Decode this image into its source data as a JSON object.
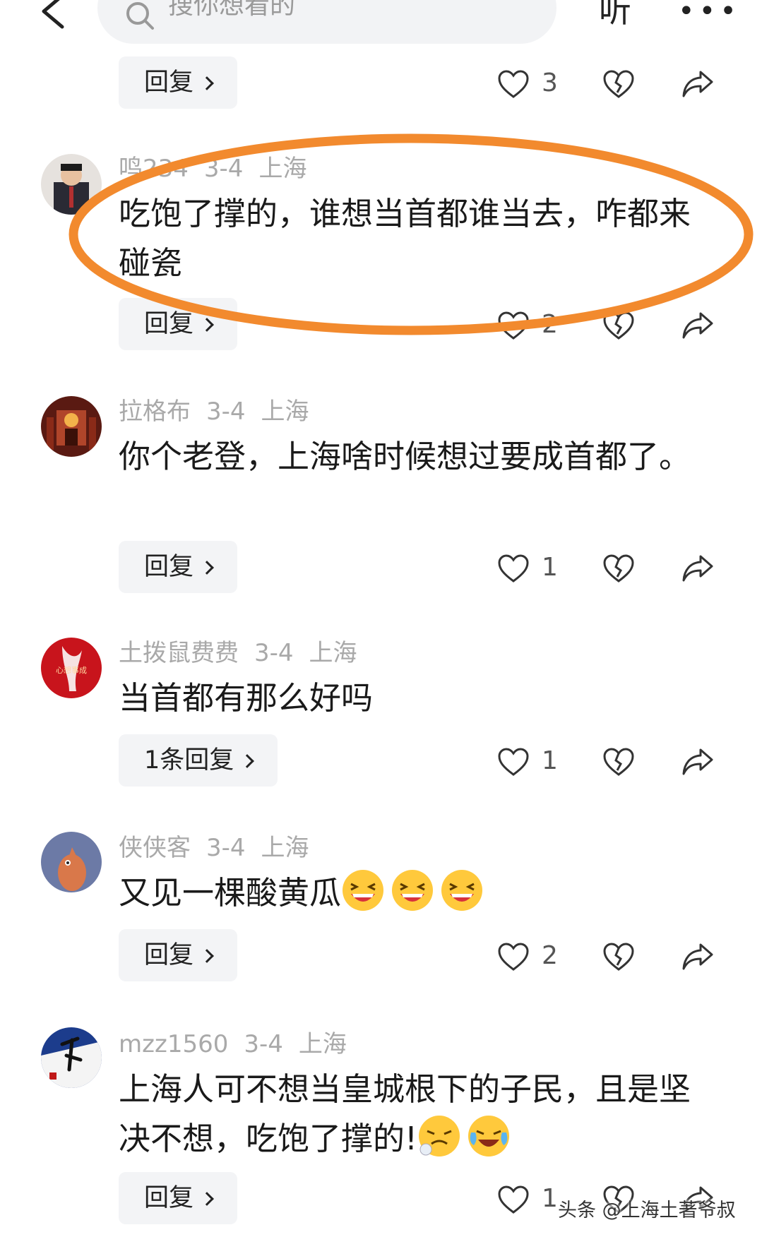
{
  "header": {
    "search_placeholder": "搜你想看的",
    "listen_label": "听",
    "more_label": "•••"
  },
  "comments": [
    {
      "username": "",
      "date": "",
      "location": "",
      "text": "",
      "reply_label": "回复",
      "likes": "3"
    },
    {
      "username": "鸣234",
      "date": "3-4",
      "location": "上海",
      "text": "吃饱了撑的，谁想当首都谁当去，咋都来碰瓷",
      "reply_label": "回复",
      "likes": "2"
    },
    {
      "username": "拉格布",
      "date": "3-4",
      "location": "上海",
      "text": "你个老登，上海啥时候想过要成首都了。",
      "reply_label": "回复",
      "likes": "1"
    },
    {
      "username": "土拨鼠费费",
      "date": "3-4",
      "location": "上海",
      "text": "当首都有那么好吗",
      "reply_label": "1条回复",
      "likes": "1"
    },
    {
      "username": "侠侠客",
      "date": "3-4",
      "location": "上海",
      "text": "又见一棵酸黄瓜",
      "reply_label": "回复",
      "likes": "2"
    },
    {
      "username": "mzz1560",
      "date": "3-4",
      "location": "上海",
      "text": "上海人可不想当皇城根下的子民，且是坚决不想，吃饱了撑的!",
      "reply_label": "回复",
      "likes": "1"
    }
  ],
  "watermark": "头条 @上海土著爷叔",
  "colors": {
    "highlight": "#f28a2e",
    "meta": "#a9a9a9",
    "button_bg": "#f3f4f6"
  }
}
